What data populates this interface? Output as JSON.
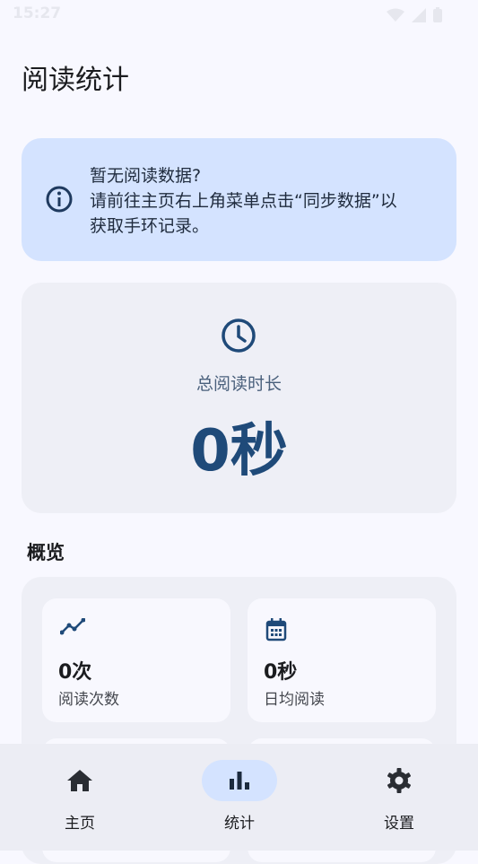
{
  "status": {
    "time": "15:27"
  },
  "page": {
    "title": "阅读统计"
  },
  "notice": {
    "line1": "暂无阅读数据?",
    "line2": "请前往主页右上角菜单点击“同步数据”以",
    "line3": "获取手环记录。",
    "icon": "info-icon"
  },
  "total": {
    "label": "总阅读时长",
    "value": "0秒",
    "icon": "clock-icon"
  },
  "overview": {
    "title": "概览",
    "tiles": [
      {
        "value": "0次",
        "label": "阅读次数",
        "icon": "trend-line-icon"
      },
      {
        "value": "0秒",
        "label": "日均阅读",
        "icon": "calendar-icon"
      }
    ]
  },
  "nav": {
    "items": [
      {
        "label": "主页",
        "icon": "home-icon",
        "active": false
      },
      {
        "label": "统计",
        "icon": "bar-chart-icon",
        "active": true
      },
      {
        "label": "设置",
        "icon": "gear-icon",
        "active": false
      }
    ]
  },
  "colors": {
    "accent": "#1f4a79",
    "notice_bg": "#d4e3ff",
    "card_bg": "#eeeff6"
  }
}
